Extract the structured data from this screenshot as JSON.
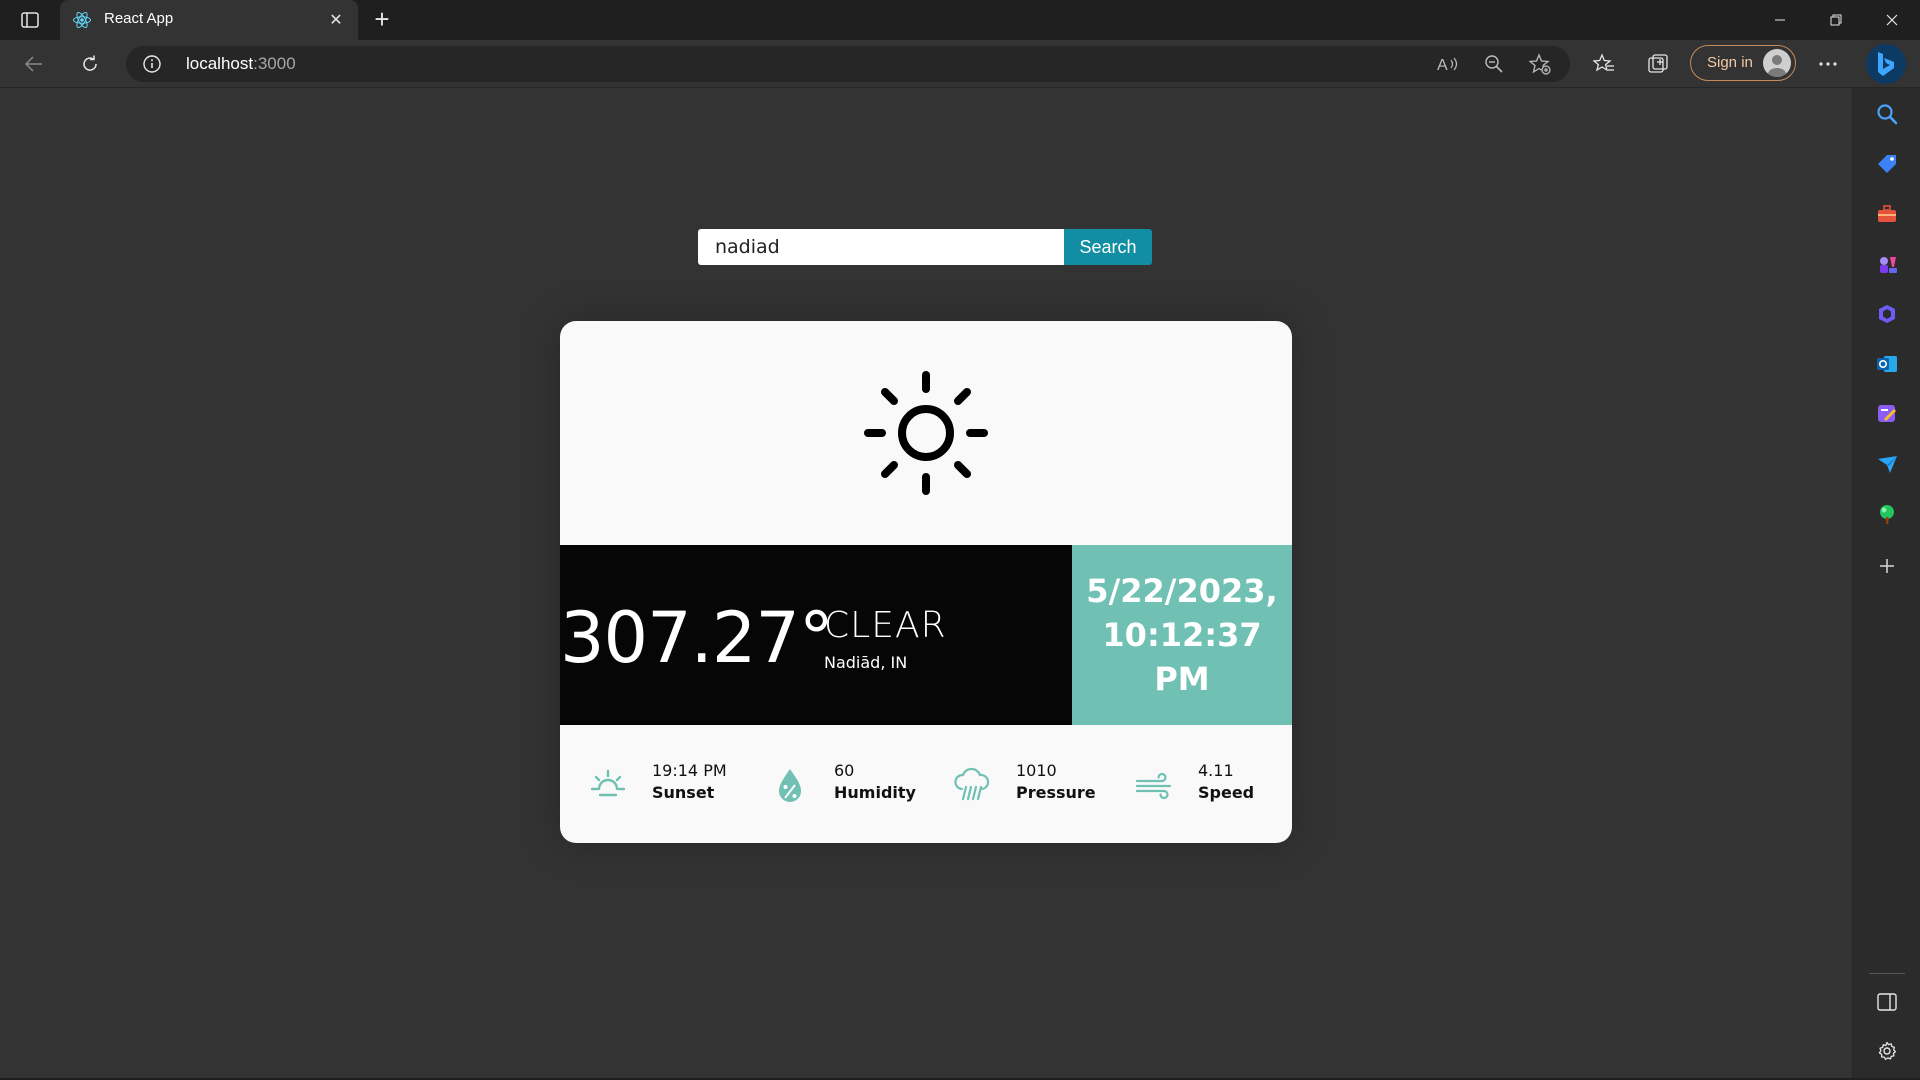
{
  "browser": {
    "tab": {
      "title": "React App",
      "favicon": "react-icon"
    },
    "address": {
      "host": "localhost",
      "port": ":3000"
    },
    "signin_label": "Sign in",
    "sidebar_icons": [
      "search-icon",
      "shopping-tag-icon",
      "tools-icon",
      "games-icon",
      "copilot-icon",
      "outlook-icon",
      "designer-icon",
      "send-icon",
      "tree-icon",
      "add-icon"
    ]
  },
  "search": {
    "value": "nadiad",
    "button_label": "Search"
  },
  "weather": {
    "icon": "sun-icon",
    "temperature": "307.27°",
    "condition": "CLEAR",
    "location": "Nadiād, IN",
    "date": "5/22/2023,",
    "time": "10:12:37 PM"
  },
  "stats": [
    {
      "icon": "sunset-icon",
      "value": "19:14 PM",
      "label": "Sunset"
    },
    {
      "icon": "humidity-icon",
      "value": "60",
      "label": "Humidity"
    },
    {
      "icon": "pressure-icon",
      "value": "1010",
      "label": "Pressure"
    },
    {
      "icon": "wind-icon",
      "value": "4.11",
      "label": "Speed"
    }
  ],
  "colors": {
    "accent_teal": "#70c0b3",
    "search_button": "#128ea4",
    "page_bg": "#333333"
  }
}
